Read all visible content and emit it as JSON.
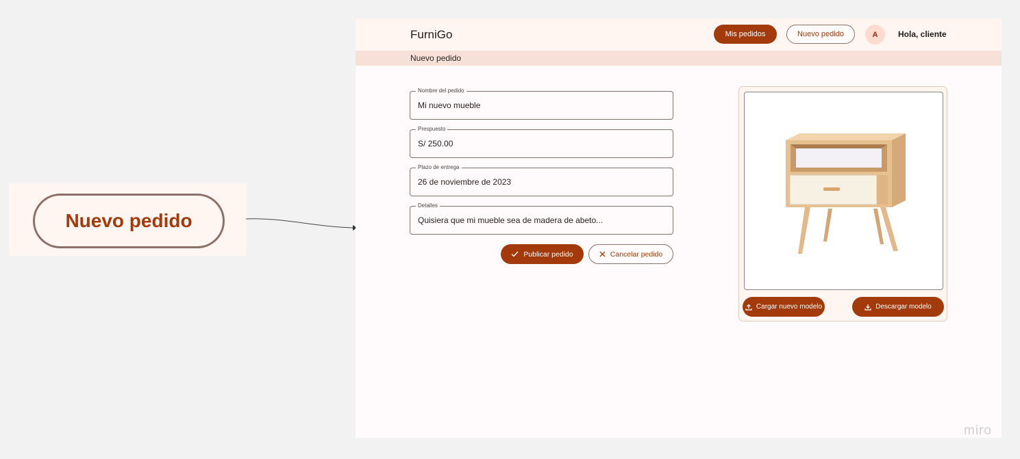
{
  "callout": {
    "label": "Nuevo pedido"
  },
  "header": {
    "brand": "FurniGo",
    "mis_pedidos": "Mis pedidos",
    "nuevo_pedido": "Nuevo pedido",
    "avatar_initial": "A",
    "greeting": "Hola, cliente"
  },
  "breadcrumb": {
    "title": "Nuevo pedido"
  },
  "form": {
    "fields": [
      {
        "label": "Nombre del pedido",
        "value": "Mi nuevo mueble"
      },
      {
        "label": "Prespuesto",
        "value": "S/ 250.00"
      },
      {
        "label": "Plazo de entrega",
        "value": "26 de noviembre de 2023"
      },
      {
        "label": "Detalles",
        "value": "Quisiera que mi mueble sea de madera de abeto..."
      }
    ],
    "publish_label": "Publicar pedido",
    "cancel_label": "Cancelar pedido"
  },
  "model": {
    "upload_label": "Cargar nuevo modelo",
    "download_label": "Descargar modelo"
  },
  "watermark": "miro",
  "colors": {
    "accent": "#a23a0b",
    "topbar": "#fff5f1",
    "crumbbar": "#f6e0d8"
  },
  "icons": [
    "check-icon",
    "close-icon",
    "upload-icon",
    "download-icon"
  ]
}
